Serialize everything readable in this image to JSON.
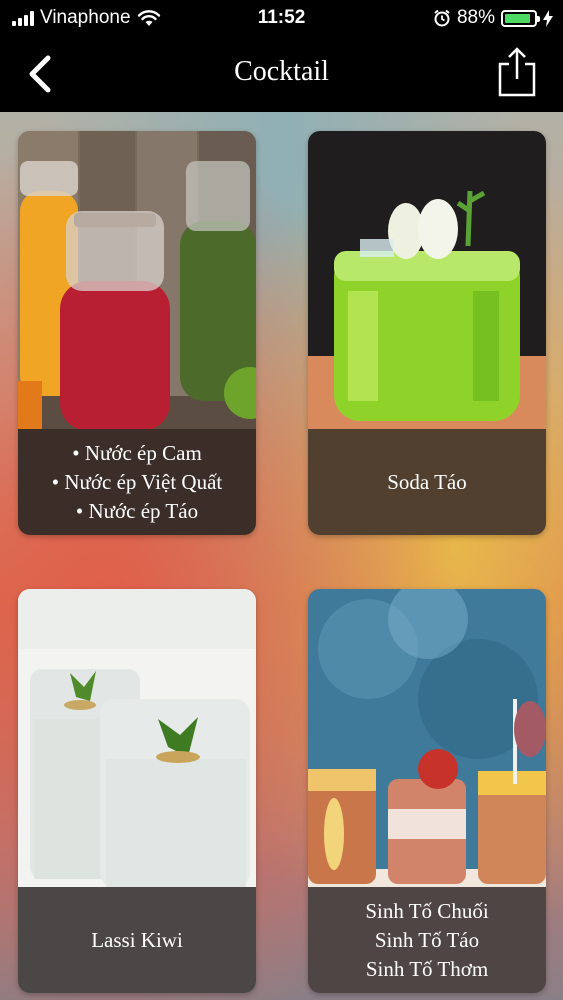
{
  "status_bar": {
    "carrier": "Vinaphone",
    "time": "11:52",
    "battery_percent": "88%",
    "battery_level": 0.88,
    "battery_color": "#4cd964"
  },
  "nav": {
    "title": "Cocktail",
    "back_icon": "chevron-left-icon",
    "share_icon": "share-icon"
  },
  "cards": [
    {
      "lines": [
        "• Nước ép Cam",
        "• Nước ép Việt Quất",
        "• Nước ép Táo"
      ]
    },
    {
      "lines": [
        "Soda Táo"
      ]
    },
    {
      "lines": [
        "Lassi Kiwi"
      ]
    },
    {
      "lines": [
        "Sinh Tố Chuối",
        "Sinh Tố Táo",
        "Sinh Tố Thơm"
      ]
    }
  ]
}
